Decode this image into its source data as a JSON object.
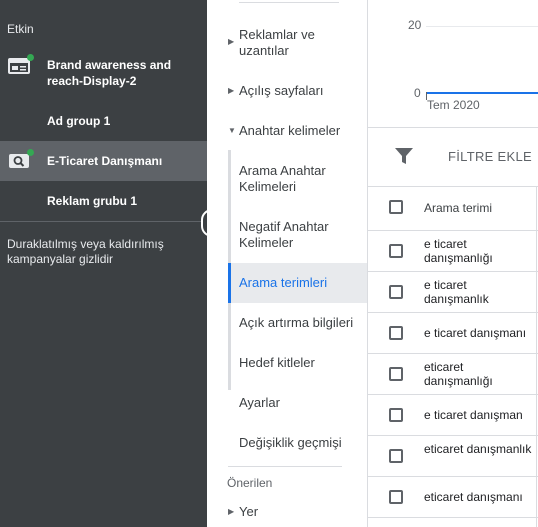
{
  "sidebar": {
    "section_label": "Etkin",
    "campaigns": [
      {
        "name": "Brand awareness and reach-Display-2",
        "icon": "display-campaign-icon",
        "status": "active"
      },
      {
        "name": "Ad group 1"
      },
      {
        "name": "E-Ticaret Danışmanı",
        "icon": "search-campaign-icon",
        "status": "active"
      },
      {
        "name": "Reklam grubu 1"
      }
    ],
    "hidden_note": "Duraklatılmış veya kaldırılmış kampanyalar gizlidir"
  },
  "nav": {
    "items": [
      {
        "label": "Reklamlar ve uzantılar",
        "expandable": true
      },
      {
        "label": "Açılış sayfaları",
        "expandable": true
      },
      {
        "label": "Anahtar kelimeler",
        "expanded": true
      },
      {
        "label": "Arama Anahtar Kelimeleri"
      },
      {
        "label": "Negatif Anahtar Kelimeler"
      },
      {
        "label": "Arama terimleri",
        "selected": true
      },
      {
        "label": "Açık artırma bilgileri"
      },
      {
        "label": "Hedef kitleler"
      },
      {
        "label": "Ayarlar"
      },
      {
        "label": "Değişiklik geçmişi"
      }
    ],
    "suggested_label": "Önerilen",
    "suggested_items": [
      {
        "label": "Yer",
        "expandable": true
      }
    ]
  },
  "chart": {
    "y_ticks": [
      "20",
      "0"
    ],
    "x_label": "Tem 2020",
    "line_color": "#1a73e8"
  },
  "toolbar": {
    "filter_label": "FİLTRE EKLE"
  },
  "table": {
    "header": "Arama terimi",
    "rows": [
      "e ticaret danışmanlığı",
      "e ticaret danışmanlık",
      "e ticaret danışmanı",
      "eticaret danışmanlığı",
      "e ticaret danışman",
      "eticaret danışmanlık",
      "eticaret danışmanı"
    ]
  },
  "colors": {
    "sidebar_bg": "#3c4043",
    "accent": "#1a73e8",
    "active_dot": "#34a853"
  }
}
